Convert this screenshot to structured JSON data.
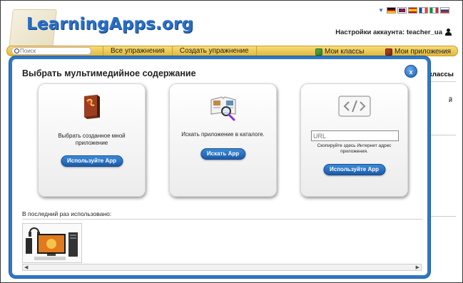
{
  "header": {
    "logo_text": "LearningApps.org",
    "account_label": "Настройки аккаунта: teacher_ua",
    "flags": [
      "german-flag",
      "uk-flag",
      "spanish-flag",
      "french-flag",
      "italian-flag",
      "russian-flag"
    ]
  },
  "nav": {
    "search_placeholder": "Поиск",
    "all_exercises": "Все упражнения",
    "create_exercise": "Создать упражнение",
    "my_classes": "Мои классы",
    "my_apps": "Мои приложения"
  },
  "background": {
    "classes_fragment": "классы",
    "letter_fragment": "й"
  },
  "modal": {
    "title": "Выбрать мультимедийное содержание",
    "close_label": "x",
    "cards": [
      {
        "text": "Выбрать созданное мной приложение",
        "button": "Используйте App",
        "icon": "book-icon"
      },
      {
        "text": "Искать приложение в каталоге.",
        "button": "Искать App",
        "icon": "catalog-search-icon"
      },
      {
        "url_placeholder": "URL",
        "text": "Скопируйте здесь Интернет адрес приложения.",
        "button": "Используйте App",
        "icon": "code-icon"
      }
    ],
    "recent_label": "В последний раз использовано:"
  },
  "colors": {
    "accent": "#2f78c4",
    "navbar": "#e8c24a",
    "button": "#1c5aa8"
  }
}
